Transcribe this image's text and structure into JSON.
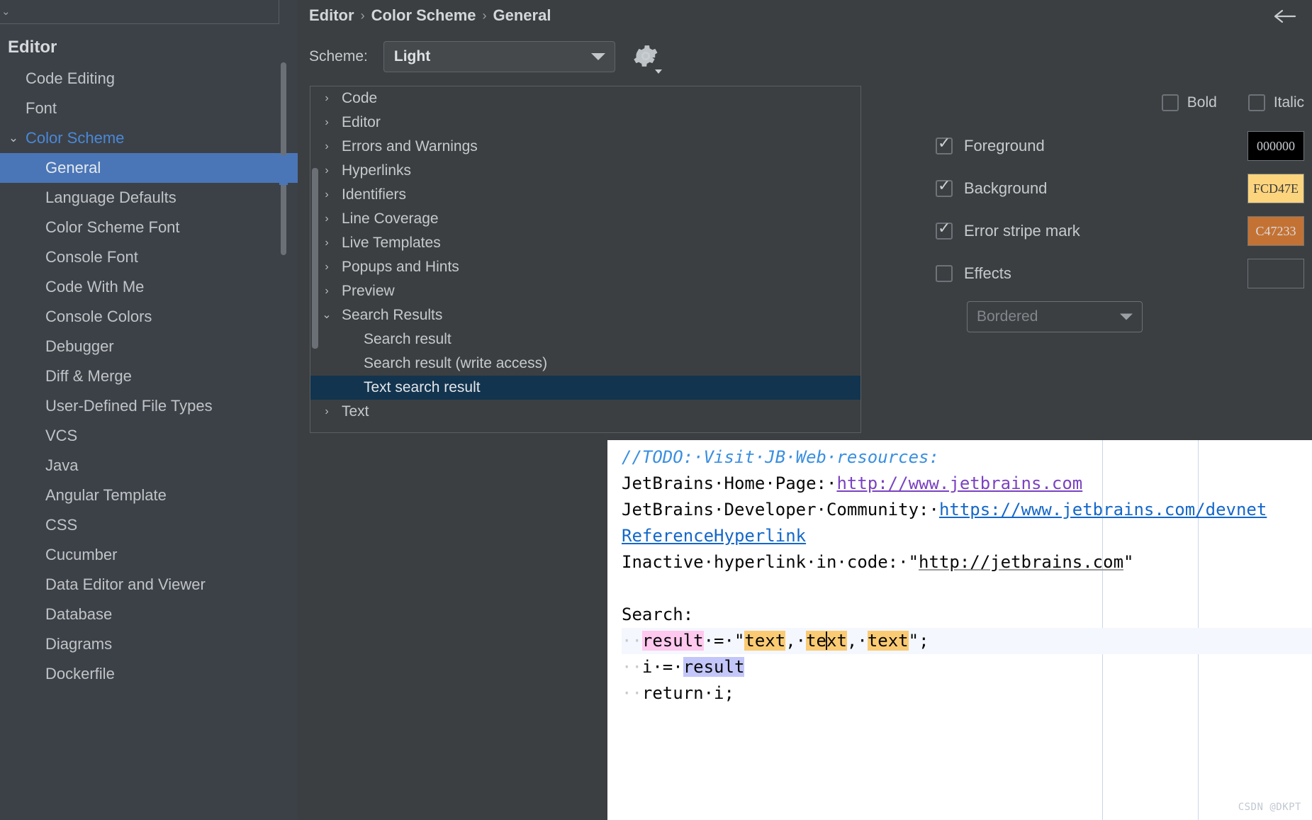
{
  "sidebar": {
    "search_placeholder": "",
    "header": "Editor",
    "items": [
      {
        "label": "Code Editing",
        "level": 1,
        "state": "none"
      },
      {
        "label": "Font",
        "level": 1,
        "state": "none"
      },
      {
        "label": "Color Scheme",
        "level": 1,
        "state": "expanded"
      },
      {
        "label": "General",
        "level": 2,
        "state": "selected"
      },
      {
        "label": "Language Defaults",
        "level": 2,
        "state": "none"
      },
      {
        "label": "Color Scheme Font",
        "level": 2,
        "state": "none"
      },
      {
        "label": "Console Font",
        "level": 2,
        "state": "none"
      },
      {
        "label": "Code With Me",
        "level": 2,
        "state": "none"
      },
      {
        "label": "Console Colors",
        "level": 2,
        "state": "none"
      },
      {
        "label": "Debugger",
        "level": 2,
        "state": "none"
      },
      {
        "label": "Diff & Merge",
        "level": 2,
        "state": "none"
      },
      {
        "label": "User-Defined File Types",
        "level": 2,
        "state": "none"
      },
      {
        "label": "VCS",
        "level": 2,
        "state": "none"
      },
      {
        "label": "Java",
        "level": 2,
        "state": "none"
      },
      {
        "label": "Angular Template",
        "level": 2,
        "state": "none"
      },
      {
        "label": "CSS",
        "level": 2,
        "state": "none"
      },
      {
        "label": "Cucumber",
        "level": 2,
        "state": "none"
      },
      {
        "label": "Data Editor and Viewer",
        "level": 2,
        "state": "none"
      },
      {
        "label": "Database",
        "level": 2,
        "state": "none"
      },
      {
        "label": "Diagrams",
        "level": 2,
        "state": "none"
      },
      {
        "label": "Dockerfile",
        "level": 2,
        "state": "none"
      }
    ]
  },
  "breadcrumb": {
    "parts": [
      "Editor",
      "Color Scheme",
      "General"
    ],
    "separator": "›"
  },
  "scheme": {
    "label": "Scheme:",
    "value": "Light"
  },
  "tree": {
    "items": [
      {
        "label": "Code",
        "child": false,
        "expanded": false,
        "selected": false
      },
      {
        "label": "Editor",
        "child": false,
        "expanded": false,
        "selected": false
      },
      {
        "label": "Errors and Warnings",
        "child": false,
        "expanded": false,
        "selected": false
      },
      {
        "label": "Hyperlinks",
        "child": false,
        "expanded": false,
        "selected": false
      },
      {
        "label": "Identifiers",
        "child": false,
        "expanded": false,
        "selected": false
      },
      {
        "label": "Line Coverage",
        "child": false,
        "expanded": false,
        "selected": false
      },
      {
        "label": "Live Templates",
        "child": false,
        "expanded": false,
        "selected": false
      },
      {
        "label": "Popups and Hints",
        "child": false,
        "expanded": false,
        "selected": false
      },
      {
        "label": "Preview",
        "child": false,
        "expanded": false,
        "selected": false
      },
      {
        "label": "Search Results",
        "child": false,
        "expanded": true,
        "selected": false
      },
      {
        "label": "Search result",
        "child": true,
        "expanded": false,
        "selected": false
      },
      {
        "label": "Search result (write access)",
        "child": true,
        "expanded": false,
        "selected": false
      },
      {
        "label": "Text search result",
        "child": true,
        "expanded": false,
        "selected": true
      },
      {
        "label": "Text",
        "child": false,
        "expanded": false,
        "selected": false
      }
    ]
  },
  "attributes": {
    "bold": {
      "label": "Bold",
      "checked": false
    },
    "italic": {
      "label": "Italic",
      "checked": false
    },
    "foreground": {
      "label": "Foreground",
      "checked": true,
      "value": "000000",
      "swatch_bg": "#000000",
      "swatch_fg": "#c9cdd1"
    },
    "background": {
      "label": "Background",
      "checked": true,
      "value": "FCD47E",
      "swatch_bg": "#FCD47E",
      "swatch_fg": "#3a3a3a"
    },
    "error_stripe": {
      "label": "Error stripe mark",
      "checked": true,
      "value": "C47233",
      "swatch_bg": "#C47233",
      "swatch_fg": "#d9dce0"
    },
    "effects": {
      "label": "Effects",
      "checked": false,
      "value": "",
      "swatch_bg": "#3c3f41",
      "swatch_fg": "#3c3f41"
    },
    "effect_type": {
      "value": "Bordered"
    }
  },
  "preview_code": {
    "lines": [
      {
        "segments": [
          {
            "text": "//TODO:·Visit·JB·Web·resources:",
            "style": "c-comment"
          }
        ]
      },
      {
        "segments": [
          {
            "text": "JetBrains·Home·Page:·",
            "style": ""
          },
          {
            "text": "http://www.jetbrains.com",
            "style": "c-link-purple"
          }
        ]
      },
      {
        "segments": [
          {
            "text": "JetBrains·Developer·Community:·",
            "style": ""
          },
          {
            "text": "https://www.jetbrains.com/devnet",
            "style": "c-link-blue"
          }
        ]
      },
      {
        "segments": [
          {
            "text": "ReferenceHyperlink",
            "style": "c-link-blue"
          }
        ]
      },
      {
        "segments": [
          {
            "text": "Inactive·hyperlink·in·code:·\"",
            "style": ""
          },
          {
            "text": "http://jetbrains.com",
            "style": "c-link-gray"
          },
          {
            "text": "\"",
            "style": ""
          }
        ]
      },
      {
        "segments": [
          {
            "text": "",
            "style": ""
          }
        ]
      },
      {
        "segments": [
          {
            "text": "Search:",
            "style": ""
          }
        ]
      },
      {
        "highlight_row": true,
        "segments": [
          {
            "text": "··",
            "style": "dot"
          },
          {
            "text": "result",
            "style": "hl-pink"
          },
          {
            "text": "·=·\"",
            "style": ""
          },
          {
            "text": "text",
            "style": "hl-amber"
          },
          {
            "text": ",·",
            "style": ""
          },
          {
            "text": "text",
            "style": "hl-amber",
            "caret_at": 2
          },
          {
            "text": ",·",
            "style": ""
          },
          {
            "text": "text",
            "style": "hl-amber"
          },
          {
            "text": "\";",
            "style": ""
          }
        ]
      },
      {
        "segments": [
          {
            "text": "··",
            "style": "dot"
          },
          {
            "text": "i·=·",
            "style": ""
          },
          {
            "text": "result",
            "style": "hl-lav"
          }
        ]
      },
      {
        "segments": [
          {
            "text": "··",
            "style": "dot"
          },
          {
            "text": "return·i;",
            "style": ""
          }
        ]
      }
    ]
  },
  "watermark": "CSDN @DKPT"
}
